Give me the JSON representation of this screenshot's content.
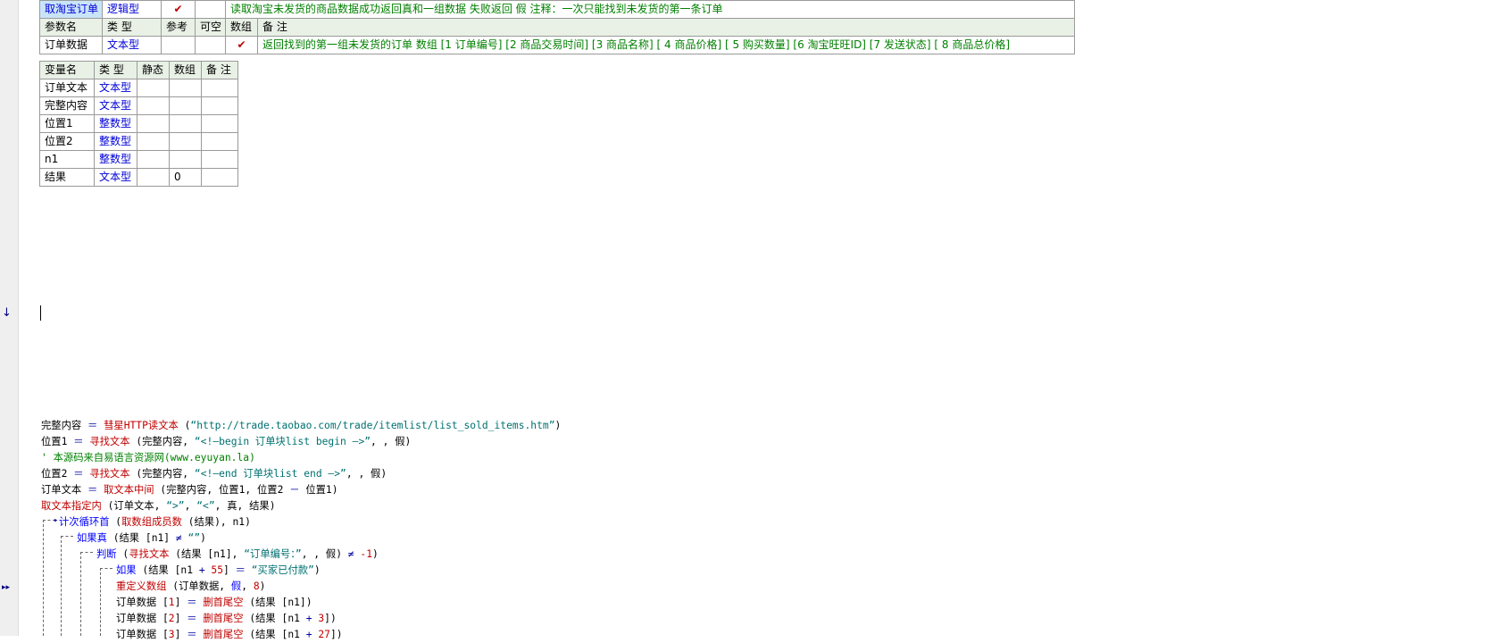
{
  "sub": {
    "name": "取淘宝订单",
    "ret_type": "逻辑型",
    "public_mark": "✔",
    "remark": "读取淘宝未发货的商品数据成功返回真和一组数据  失败返回 假  注释：一次只能找到未发货的第一条订单"
  },
  "param_header": [
    "参数名",
    "类 型",
    "参考",
    "可空",
    "数组",
    "备 注"
  ],
  "param": {
    "name": "订单数据",
    "type": "文本型",
    "array_mark": "✔",
    "remark": "返回找到的第一组未发货的订单 数组 [1 订单编号] [2 商品交易时间] [3 商品名称] [ 4 商品价格] [ 5 购买数量] [6 淘宝旺旺ID] [7 发送状态] [ 8 商品总价格]"
  },
  "var_header": [
    "变量名",
    "类 型",
    "静态",
    "数组",
    "备 注"
  ],
  "vars": [
    {
      "name": "订单文本",
      "type": "文本型",
      "static": "",
      "array": "",
      "remark": ""
    },
    {
      "name": "完整内容",
      "type": "文本型",
      "static": "",
      "array": "",
      "remark": ""
    },
    {
      "name": "位置1",
      "type": "整数型",
      "static": "",
      "array": "",
      "remark": ""
    },
    {
      "name": "位置2",
      "type": "整数型",
      "static": "",
      "array": "",
      "remark": ""
    },
    {
      "name": "n1",
      "type": "整数型",
      "static": "",
      "array": "",
      "remark": ""
    },
    {
      "name": "结果",
      "type": "文本型",
      "static": "",
      "array": "0",
      "remark": ""
    }
  ],
  "gutter": {
    "down_marker": "↓",
    "current_marker": "▸▸"
  },
  "code": {
    "l1": {
      "a": "完整内容 ",
      "op": "＝",
      "fn": " 彗星HTTP读文本",
      "b": " (",
      "s": "“http://trade.taobao.com/trade/itemlist/list_sold_items.htm”",
      "c": ")"
    },
    "l2": {
      "a": "位置1 ",
      "op": "＝",
      "fn": " 寻找文本",
      "b": " (完整内容, ",
      "s": "“<!—begin 订单块list begin —>”",
      "c": ", , 假)"
    },
    "l3": {
      "cmt": "' 本源码来自易语言资源网(www.eyuyan.la)"
    },
    "l4": {
      "a": "位置2 ",
      "op": "＝",
      "fn": " 寻找文本",
      "b": " (完整内容, ",
      "s": "“<!—end 订单块list end —>”",
      "c": ", , 假)"
    },
    "l5": {
      "a": "订单文本 ",
      "op": "＝",
      "fn": " 取文本中间",
      "b": " (完整内容, 位置1, 位置2 ",
      "op2": "－",
      "c": " 位置1)"
    },
    "l6": {
      "fn": "取文本指定内",
      "b": " (订单文本, ",
      "s1": "“>”",
      "m": ", ",
      "s2": "“<”",
      "c": ", 真, 结果)"
    },
    "l7": {
      "kw": "计次循环首",
      "b": " (",
      "fn": "取数组成员数",
      "c": " (结果), n1)"
    },
    "l8": {
      "kw": "如果真",
      "b": " (结果 [n1] ",
      "op": "≠",
      "s": " “”",
      "c": ")"
    },
    "l9": {
      "kw": "判断",
      "b": " (",
      "fn": "寻找文本",
      "c": " (结果 [n1], ",
      "s": "“订单编号：”",
      "d": ", , 假) ",
      "op": "≠",
      "n": " -1",
      "e": ")"
    },
    "l10": {
      "kw": "如果",
      "b": " (结果 [n1 ",
      "op": "+",
      "n": " 55",
      "c": "] ",
      "op2": "＝",
      "s": " “买家已付款”",
      "d": ")"
    },
    "l11": {
      "fn": "重定义数组",
      "b": " (订单数据, ",
      "kw": "假",
      "c": ", ",
      "n": "8",
      "d": ")"
    },
    "l12": {
      "a": "订单数据 [",
      "n": "1",
      "b": "] ",
      "op": "＝",
      "fn": " 删首尾空",
      "c": " (结果 [n1])"
    },
    "l13": {
      "a": "订单数据 [",
      "n": "2",
      "b": "] ",
      "op": "＝",
      "fn": " 删首尾空",
      "c": " (结果 [n1 ",
      "op2": "+",
      "n2": " 3",
      "d": "])"
    },
    "l14": {
      "a": "订单数据 [",
      "n": "3",
      "b": "] ",
      "op": "＝",
      "fn": " 删首尾空",
      "c": " (结果 [n1 ",
      "op2": "+",
      "n2": " 27",
      "d": "])"
    }
  }
}
